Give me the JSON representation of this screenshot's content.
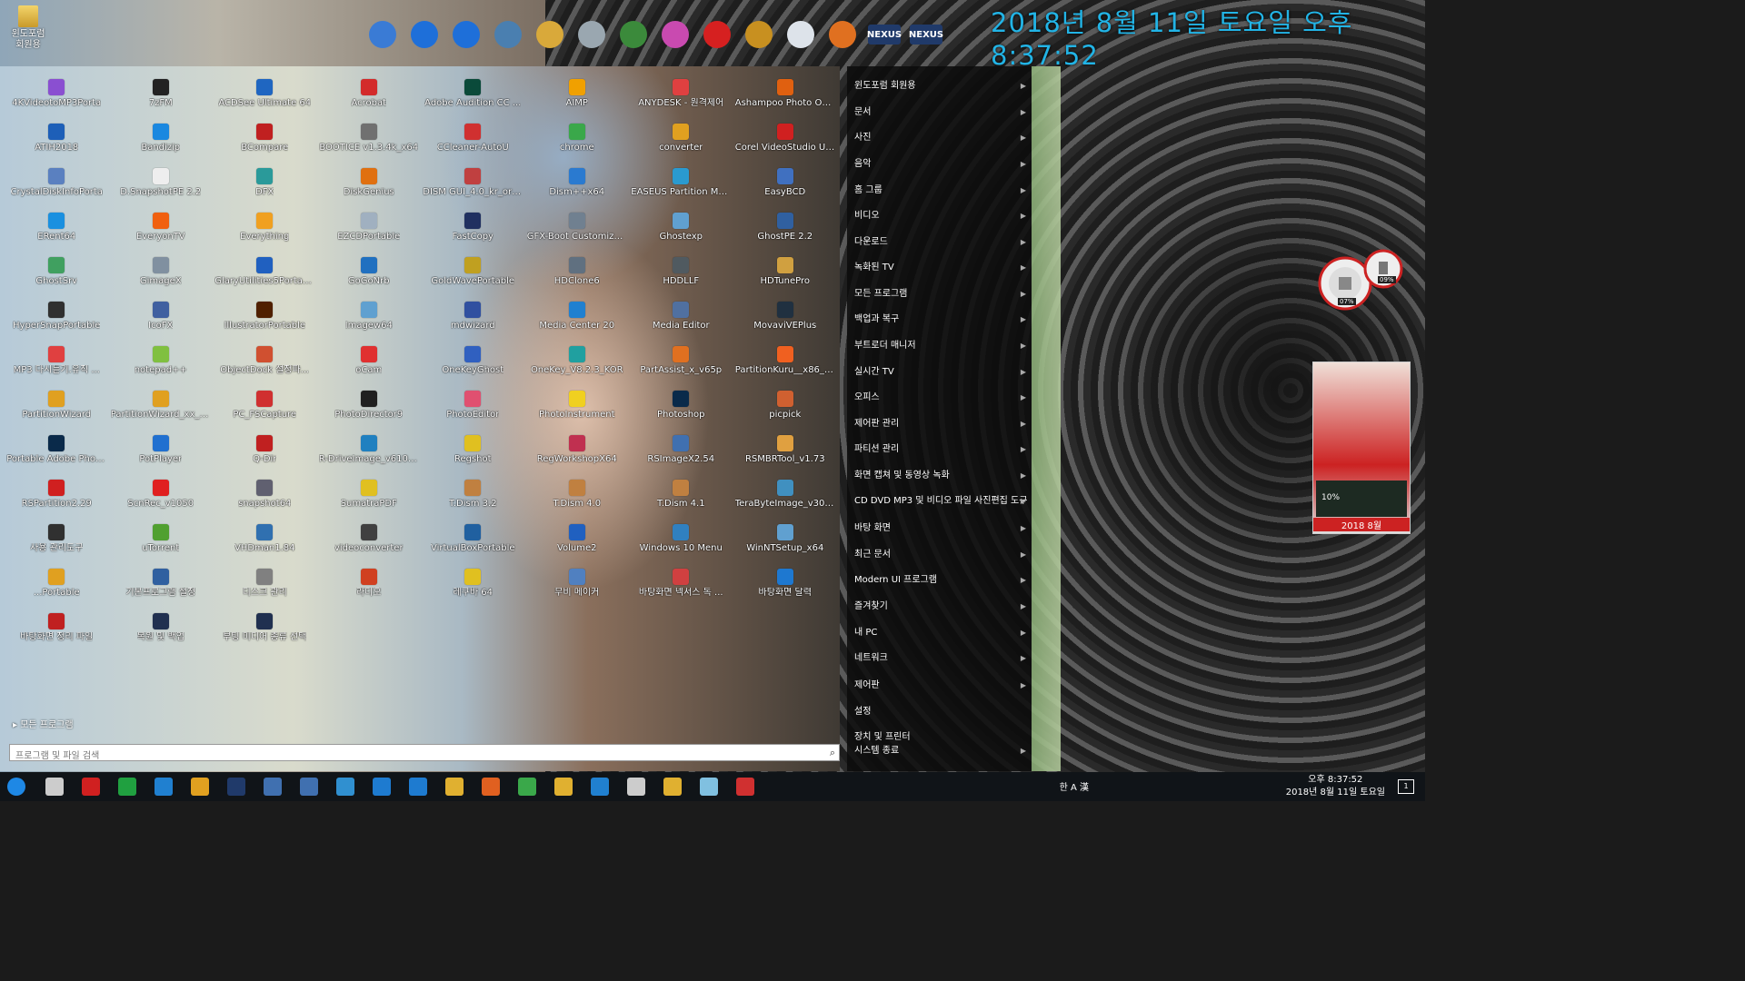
{
  "desktop": {
    "icon_label": "윈도포럼\n회원용",
    "clock": "2018년 8월 11일 토요일 오후 8:37:52"
  },
  "toolbar": {
    "icons": [
      {
        "name": "ship-icon",
        "color": "#3a7bd5"
      },
      {
        "name": "undo-icon",
        "color": "#1e6fd9"
      },
      {
        "name": "redo-icon",
        "color": "#1e6fd9"
      },
      {
        "name": "monitor-icon",
        "color": "#4a7fb0"
      },
      {
        "name": "key-icon",
        "color": "#d9a93a"
      },
      {
        "name": "trash-icon",
        "color": "#9aa7b0"
      },
      {
        "name": "globe-icon",
        "color": "#3b8a3b"
      },
      {
        "name": "megaphone-icon",
        "color": "#c94ab0"
      },
      {
        "name": "power-icon",
        "color": "#d62020"
      },
      {
        "name": "dial-icon",
        "color": "#c89020"
      },
      {
        "name": "magnifier-icon",
        "color": "#dde3ea"
      },
      {
        "name": "orb-icon",
        "color": "#e07020"
      }
    ],
    "nexus": [
      "NEXUS",
      "NEXUS"
    ]
  },
  "apps": [
    {
      "label": "4KVideotoMP3Porta",
      "color": "#8a4fd1"
    },
    {
      "label": "7zFM",
      "color": "#222"
    },
    {
      "label": "ACDSee Ultimate 64",
      "color": "#1f66c1"
    },
    {
      "label": "Acrobat",
      "color": "#d32b2b"
    },
    {
      "label": "Adobe Audition CC ...",
      "color": "#0a4a3a"
    },
    {
      "label": "AIMP",
      "color": "#f0a000"
    },
    {
      "label": "ANYDESK - 원격제어",
      "color": "#e04040"
    },
    {
      "label": "Ashampoo Photo Op...",
      "color": "#e06010"
    },
    {
      "label": "ATIH2018",
      "color": "#1d5fb8"
    },
    {
      "label": "Bandizip",
      "color": "#1a88e0"
    },
    {
      "label": "BCompare",
      "color": "#c02020"
    },
    {
      "label": "BOOTICE v1.3.4k_x64",
      "color": "#707070"
    },
    {
      "label": "CCleaner-AutoU",
      "color": "#d03030"
    },
    {
      "label": "chrome",
      "color": "#3aa84a"
    },
    {
      "label": "converter",
      "color": "#e0a020"
    },
    {
      "label": "Corel VideoStudio Ul...",
      "color": "#d02020"
    },
    {
      "label": "CrystalDiskInfoPorta",
      "color": "#5a80c0"
    },
    {
      "label": "D.SnapshotPE 2.2",
      "color": "#eeeeee"
    },
    {
      "label": "DFX",
      "color": "#2a9a9a"
    },
    {
      "label": "DiskGenius",
      "color": "#e07010"
    },
    {
      "label": "DISM GUI_4.0_kr_ori...",
      "color": "#c04040"
    },
    {
      "label": "Dism++x64",
      "color": "#2a7ad0"
    },
    {
      "label": "EASEUS Partition Ma...",
      "color": "#2a9ad0"
    },
    {
      "label": "EasyBCD",
      "color": "#4070c0"
    },
    {
      "label": "ERent64",
      "color": "#1a90e0"
    },
    {
      "label": "EveryonTV",
      "color": "#f06010"
    },
    {
      "label": "Everything",
      "color": "#f0a020"
    },
    {
      "label": "EZCDPortable",
      "color": "#a0b0c0"
    },
    {
      "label": "FastCopy",
      "color": "#203060"
    },
    {
      "label": "GFX-Boot Customize...",
      "color": "#708090"
    },
    {
      "label": "Ghostexp",
      "color": "#60a0d0"
    },
    {
      "label": "GhostPE 2.2",
      "color": "#3060a0"
    },
    {
      "label": "GhostSrv",
      "color": "#40a060"
    },
    {
      "label": "GimageX",
      "color": "#8090a0"
    },
    {
      "label": "GlaryUtilities5Portable",
      "color": "#2060c0"
    },
    {
      "label": "GoGoNrb",
      "color": "#2070c0"
    },
    {
      "label": "GoldWavePortable",
      "color": "#c0a020"
    },
    {
      "label": "HDClone6",
      "color": "#607080"
    },
    {
      "label": "HDDLLF",
      "color": "#505a60"
    },
    {
      "label": "HDTunePro",
      "color": "#d0a040"
    },
    {
      "label": "HyperSnapPortable",
      "color": "#303030"
    },
    {
      "label": "IcoFX",
      "color": "#4060a0"
    },
    {
      "label": "IllustratorPortable",
      "color": "#502000"
    },
    {
      "label": "Imagew64",
      "color": "#60a0d0"
    },
    {
      "label": "mdwizard",
      "color": "#3050a0"
    },
    {
      "label": "Media Center 20",
      "color": "#2080d0"
    },
    {
      "label": "Media Editor",
      "color": "#5070a0"
    },
    {
      "label": "MovaviVEPlus",
      "color": "#203040"
    },
    {
      "label": "MP3 다시듣기.유직 ...",
      "color": "#e04040"
    },
    {
      "label": "notepad++",
      "color": "#80c040"
    },
    {
      "label": "ObjectDock  설정파...",
      "color": "#d05030"
    },
    {
      "label": "oCam",
      "color": "#e03030"
    },
    {
      "label": "OneKeyGhost",
      "color": "#3060c0"
    },
    {
      "label": "OneKey_V8.2.3_KOR",
      "color": "#20a0a0"
    },
    {
      "label": "PartAssist_x_v65p",
      "color": "#e07020"
    },
    {
      "label": "PartitionKuru__x86_x...",
      "color": "#f06020"
    },
    {
      "label": "PartitionWizard",
      "color": "#e0a020"
    },
    {
      "label": "PartitionWizard_xx_v...",
      "color": "#e0a020"
    },
    {
      "label": "PC_FSCapture",
      "color": "#d03030"
    },
    {
      "label": "PhotoDirector9",
      "color": "#202020"
    },
    {
      "label": "PhotoEditor",
      "color": "#e05070"
    },
    {
      "label": "PhotoInstrument",
      "color": "#f0d020"
    },
    {
      "label": "Photoshop",
      "color": "#0a2a4a"
    },
    {
      "label": "picpick",
      "color": "#d06030"
    },
    {
      "label": "Portable Adobe Phot...",
      "color": "#0a2a4a"
    },
    {
      "label": "PotPlayer",
      "color": "#2070d0"
    },
    {
      "label": "Q-Dir",
      "color": "#c02020"
    },
    {
      "label": "R-DriveImage_v6108p",
      "color": "#2080c0"
    },
    {
      "label": "Regshot",
      "color": "#e0c020"
    },
    {
      "label": "RegWorkshopX64",
      "color": "#c03050"
    },
    {
      "label": "RSImageX2.54",
      "color": "#4070b0"
    },
    {
      "label": "RSMBRTool_v1.73",
      "color": "#e0a040"
    },
    {
      "label": "RSPartition2.29",
      "color": "#d02020"
    },
    {
      "label": "ScnRec_v1050",
      "color": "#e02020"
    },
    {
      "label": "snapshot64",
      "color": "#606070"
    },
    {
      "label": "SumatraPDF",
      "color": "#e0c020"
    },
    {
      "label": "T.Dism 3.2",
      "color": "#c08040"
    },
    {
      "label": "T.Dism 4.0",
      "color": "#c08040"
    },
    {
      "label": "T.Dism 4.1",
      "color": "#c08040"
    },
    {
      "label": "TeraByteImage_v306ap",
      "color": "#4090c0"
    },
    {
      "label": "사용 관리도구",
      "color": "#303030"
    },
    {
      "label": "uTorrent",
      "color": "#50a030"
    },
    {
      "label": "VHDman1.84",
      "color": "#3070b0"
    },
    {
      "label": "videoconverter",
      "color": "#404040"
    },
    {
      "label": "VirtualBoxPortable",
      "color": "#2060a0"
    },
    {
      "label": "Volume2",
      "color": "#2060c0"
    },
    {
      "label": "Windows 10 Menu",
      "color": "#3080c0"
    },
    {
      "label": "WinNTSetup_x64",
      "color": "#60a0d0"
    },
    {
      "label": "...Portable",
      "color": "#e0a020"
    },
    {
      "label": "기본프로그램 설정",
      "color": "#3060a0"
    },
    {
      "label": "디스크 관리",
      "color": "#808080"
    },
    {
      "label": "라디오",
      "color": "#d04020"
    },
    {
      "label": "레쿠바 64",
      "color": "#e0c020"
    },
    {
      "label": "무비 메이커",
      "color": "#5080c0"
    },
    {
      "label": "바탕화면 넥서스 독 ...",
      "color": "#d04040"
    },
    {
      "label": "바탕화면 달력",
      "color": "#1e78d0"
    },
    {
      "label": "바탕화면 정리 파일",
      "color": "#c02020"
    },
    {
      "label": "복원 및 백업",
      "color": "#203050"
    },
    {
      "label": "부팅 미디어 종류 선택",
      "color": "#203050"
    }
  ],
  "start": {
    "all_programs": "모든 프로그램",
    "search_placeholder": "프로그램 및 파일 검색"
  },
  "right_menu": [
    {
      "label": "윈도포럼 회원용",
      "arrow": true
    },
    {
      "label": "문서",
      "arrow": true
    },
    {
      "label": "사진",
      "arrow": true
    },
    {
      "label": "음악",
      "arrow": true
    },
    {
      "label": "홈 그룹",
      "arrow": true
    },
    {
      "label": "비디오",
      "arrow": true
    },
    {
      "label": "다운로드",
      "arrow": true
    },
    {
      "label": "녹화된 TV",
      "arrow": true
    },
    {
      "label": "모든 프로그램",
      "arrow": true
    },
    {
      "label": "백업과 복구",
      "arrow": true
    },
    {
      "label": "부트로더 매니저",
      "arrow": true
    },
    {
      "label": "실시간 TV",
      "arrow": true
    },
    {
      "label": "오피스",
      "arrow": true
    },
    {
      "label": "제어판 관리",
      "arrow": true
    },
    {
      "label": "파티션 관리",
      "arrow": true
    },
    {
      "label": "화면 캡쳐 및 동영상 녹화",
      "arrow": true
    },
    {
      "label": "CD DVD MP3 및 비디오 파일 사진편집 도구",
      "arrow": true
    },
    {
      "label": "바탕 화면",
      "arrow": true
    },
    {
      "label": "최근 문서",
      "arrow": true
    },
    {
      "label": "Modern UI 프로그램",
      "arrow": true
    },
    {
      "label": "즐겨찾기",
      "arrow": true
    },
    {
      "label": "내 PC",
      "arrow": true
    },
    {
      "label": "네트워크",
      "arrow": true
    },
    {
      "label": "제어판",
      "arrow": true
    },
    {
      "label": "설정",
      "arrow": false
    },
    {
      "label": "장치 및 프린터",
      "arrow": false
    },
    {
      "label": "시스템 종료",
      "arrow": true
    }
  ],
  "gadgets": {
    "gauge_left": "07%",
    "gauge_right": "09%",
    "volume": "10%",
    "date": "2018 8월"
  },
  "taskbar": {
    "icons": [
      {
        "name": "start-orb-icon",
        "color": "#1e88e5"
      },
      {
        "name": "task-view-icon",
        "color": "#cccccc"
      },
      {
        "name": "app-red-icon",
        "color": "#d02020"
      },
      {
        "name": "app-green-icon",
        "color": "#20a040"
      },
      {
        "name": "app-blue-arrow-icon",
        "color": "#2080d0"
      },
      {
        "name": "power-orange-icon",
        "color": "#e0a020"
      },
      {
        "name": "nexus-icon",
        "color": "#203a6a"
      },
      {
        "name": "monitor-icon",
        "color": "#4070b0"
      },
      {
        "name": "monitor2-icon",
        "color": "#4070b0"
      },
      {
        "name": "gear-icon",
        "color": "#3090d0"
      },
      {
        "name": "ie-icon",
        "color": "#1e7bd0"
      },
      {
        "name": "edge-icon",
        "color": "#1e7bd0"
      },
      {
        "name": "folder-icon",
        "color": "#e0b030"
      },
      {
        "name": "firefox-icon",
        "color": "#e06020"
      },
      {
        "name": "chrome-icon",
        "color": "#3aa84a"
      },
      {
        "name": "explorer-icon",
        "color": "#e0b030"
      },
      {
        "name": "store-icon",
        "color": "#2080d0"
      },
      {
        "name": "mail-icon",
        "color": "#cccccc"
      },
      {
        "name": "folder2-icon",
        "color": "#e0b030"
      },
      {
        "name": "notes-icon",
        "color": "#80c0e0"
      },
      {
        "name": "capture-icon",
        "color": "#d03030"
      }
    ],
    "ime": "한 A 漢",
    "clock_time": "오후 8:37:52",
    "clock_date": "2018년 8월 11일 토요일",
    "notif": "1"
  }
}
